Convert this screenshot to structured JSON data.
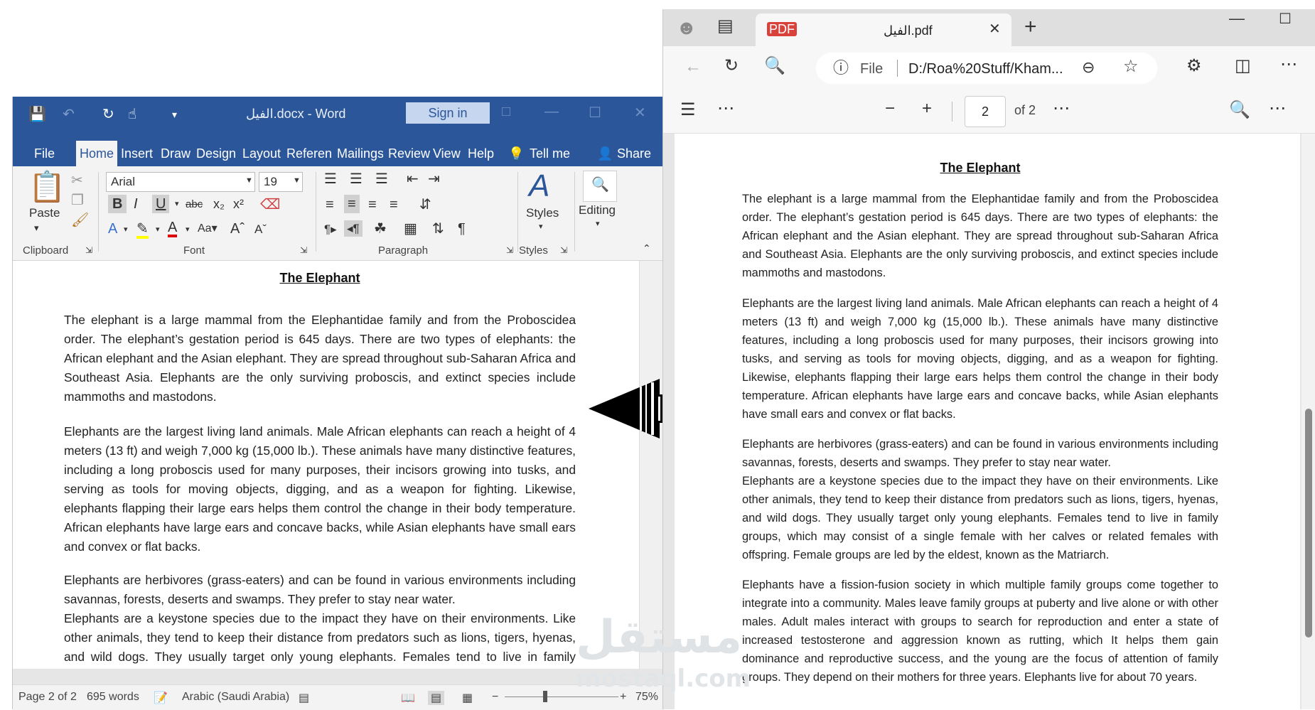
{
  "word": {
    "doc_title": "الفيل.docx  -  Word",
    "sign_in": "Sign in",
    "tabs": [
      "File",
      "Home",
      "Insert",
      "Draw",
      "Design",
      "Layout",
      "Referen",
      "Mailings",
      "Review",
      "View",
      "Help"
    ],
    "tell_me": "Tell me",
    "share": "Share",
    "font_name": "Arial",
    "font_size": "19",
    "paste": "Paste",
    "styles": "Styles",
    "editing": "Editing",
    "groups": [
      "Clipboard",
      "Font",
      "Paragraph",
      "Styles"
    ],
    "status": {
      "page": "Page 2 of 2",
      "words": "695 words",
      "language": "Arabic (Saudi Arabia)",
      "zoom": "75%"
    }
  },
  "document": {
    "title": "The Elephant",
    "paragraphs": [
      "The elephant is a large mammal from the Elephantidae family and from the Proboscidea order. The elephant’s gestation period is 645 days. There are two types of elephants: the African elephant and the Asian elephant. They are spread throughout sub-Saharan Africa and Southeast Asia. Elephants are the only surviving proboscis, and extinct species include mammoths and mastodons.",
      "Elephants are the largest living land animals. Male African elephants can reach a height of 4 meters (13 ft) and weigh 7,000 kg (15,000 lb.). These animals have many distinctive features, including a long proboscis used for many purposes, their incisors growing into tusks, and serving as tools for moving objects, digging, and as a weapon for fighting. Likewise, elephants flapping their large ears helps them control the change in their body temperature. African elephants have large ears and concave backs, while Asian elephants have small ears and convex or flat backs.",
      "Elephants are herbivores (grass-eaters) and can be found in various environments including savannas, forests, deserts and swamps. They prefer to stay near water.",
      "Elephants are a keystone species due to the impact they have on their environments. Like other animals, they tend to keep their distance from predators such as lions, tigers, hyenas, and wild dogs. They usually target only young elephants. Females tend to live in family groups, which may consist of a single female with her calves or related females with offspring. Female groups are led by the eldest, known as the Matriarch.",
      "Elephants have a fission-fusion society in which multiple family groups come together to integrate into a community. Males leave family groups at puberty and live alone or with other males. Adult males interact with groups to search for reproduction and enter a state of increased testosterone and aggression known as rutting, which It helps them gain dominance and reproductive success, and the young are the focus of attention of family groups. They depend on their mothers for three years. Elephants live for about 70 years."
    ]
  },
  "edge": {
    "tab_title": "الفيل.pdf",
    "address_scheme": "File",
    "address": "D:/Roa%20Stuff/Kham...",
    "page_number": "2",
    "page_total": "of 2"
  },
  "watermark": {
    "ar": "مستقل",
    "en": "mostaql.com"
  }
}
